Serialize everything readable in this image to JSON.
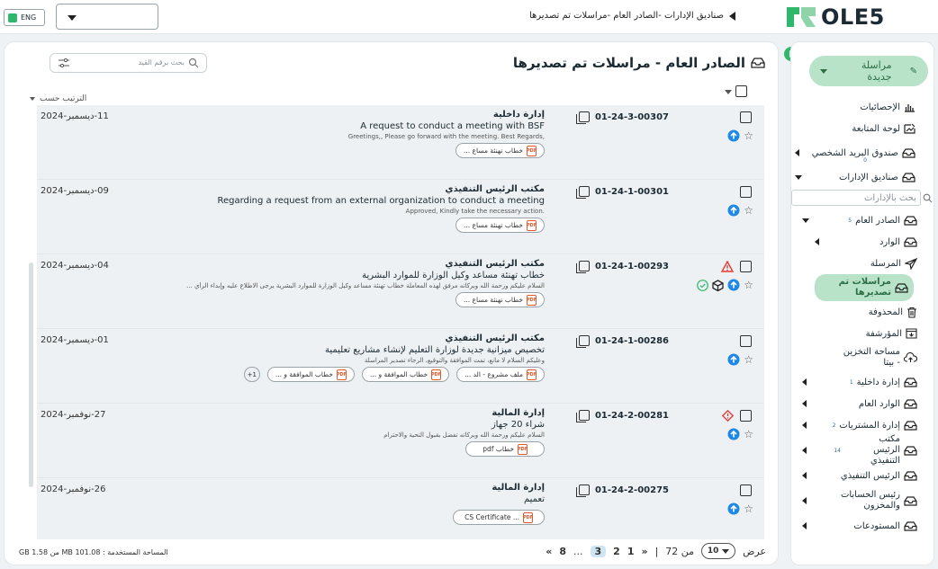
{
  "topbar": {
    "lang": "ENG",
    "breadcrumb": "صناديق الإدارات  -الصادر العام -مراسلات تم تصديرها",
    "logo_text": "OLE5"
  },
  "main": {
    "title": "الصادر العام - مراسلات تم تصديرها",
    "search_placeholder": "بحث برقم القيد",
    "sort_label": "الترتيب حسب",
    "rows": [
      {
        "ref": "01-24-3-00307",
        "dept": "إدارة داخلية",
        "subject": "A request to conduct a meeting with BSF",
        "preview": "Greetings,, Please go forward with the meeting. Best Regards,",
        "date": "11-ديسمبر-2024",
        "attachments": [
          "خطاب تهنئة مساع ..."
        ],
        "flags": {
          "warn": false,
          "diamond": false,
          "extra": false
        }
      },
      {
        "ref": "01-24-1-00301",
        "dept": "مكتب الرئيس التنفيذي",
        "subject": "Regarding a request from an external organization to conduct a meeting",
        "preview": "Approved, Kindly take the necessary action.",
        "date": "09-ديسمبر-2024",
        "attachments": [
          "خطاب تهنئة مساع ..."
        ],
        "flags": {
          "warn": false,
          "diamond": false,
          "extra": false
        }
      },
      {
        "ref": "01-24-1-00293",
        "dept": "مكتب الرئيس التنفيذي",
        "subject": "خطاب تهنئة مساعد وكيل الوزارة للموارد البشرية",
        "preview": "السلام عليكم ورحمة الله وبركاته مرفق لهذه المعاملة خطاب تهنئة مساعد وكيل الوزارة للموارد البشرية يرجى الاطلاع عليه وإبداء الرأي ...",
        "date": "04-ديسمبر-2024",
        "attachments": [
          "خطاب تهنئة مساع ..."
        ],
        "flags": {
          "warn": true,
          "diamond": false,
          "extra": true
        }
      },
      {
        "ref": "01-24-1-00286",
        "dept": "مكتب الرئيس التنفيذي",
        "subject": "تخصيص ميزانية جديدة لوزارة التعليم لإنشاء مشاريع تعليمية",
        "preview": "وعليكم السلام لا مانع، تمت الموافقة والتوقيع، الرجاء تصدير المراسلة",
        "date": "01-ديسمبر-2024",
        "attachments": [
          "ملف مشروع - الد ...",
          "خطاب الموافقة و ...",
          "خطاب الموافقة و ..."
        ],
        "more": "1+",
        "flags": {
          "warn": false,
          "diamond": false,
          "extra": false
        }
      },
      {
        "ref": "01-24-2-00281",
        "dept": "إدارة المالية",
        "subject": "شراء 20 جهاز",
        "preview": "السلام عليكم ورحمة الله وبركاته تفضل بقبول التحية والاحترام",
        "date": "27-نوفمبر-2024",
        "attachments": [
          "خطاب pdf"
        ],
        "flags": {
          "warn": false,
          "diamond": true,
          "extra": false
        }
      },
      {
        "ref": "01-24-2-00275",
        "dept": "إدارة المالية",
        "subject": "تعميم",
        "preview": "",
        "date": "26-نوفمبر-2024",
        "attachments": [
          "CS Certificate ..."
        ],
        "flags": {
          "warn": false,
          "diamond": false,
          "extra": false
        }
      }
    ],
    "footer": {
      "space_used": "المساحة المستخدمة : 101.08 MB من 1.58 GB",
      "show_label": "عرض",
      "page_size": "10",
      "of_label": "من 72",
      "sep": "|",
      "pages": [
        "1",
        "2",
        "3",
        "...",
        "8"
      ],
      "current_page": "3",
      "first": "«",
      "last": "»"
    }
  },
  "sidebar": {
    "new_message": "مراسلة جديدة",
    "search_placeholder": "بحث بالإدارات",
    "items": [
      {
        "label": "الإحصائيات",
        "level": 1
      },
      {
        "label": "لوحة المتابعة",
        "level": 1
      },
      {
        "label": "صندوق البريد الشخصي",
        "level": 1,
        "badge": "0",
        "arrow": "left"
      },
      {
        "label": "صناديق الإدارات",
        "level": 1,
        "arrow": "down"
      },
      {
        "label": "الصادر العام",
        "level": 2,
        "badge": "5",
        "arrow": "down"
      },
      {
        "label": "الوارد",
        "level": 3,
        "arrow": "left"
      },
      {
        "label": "المرسلة",
        "level": 3
      },
      {
        "label": "مراسلات تم تصديرها",
        "level": 3,
        "active": true
      },
      {
        "label": "المحذوفة",
        "level": 3
      },
      {
        "label": "المؤرشفة",
        "level": 3
      },
      {
        "label": "مساحة التخزين - بيتا",
        "level": 3
      },
      {
        "label": "إدارة داخلية",
        "level": 2,
        "badge": "1",
        "arrow": "left"
      },
      {
        "label": "الوارد العام",
        "level": 2,
        "arrow": "left"
      },
      {
        "label": "إدارة المشتريات",
        "level": 2,
        "badge": "2",
        "arrow": "left"
      },
      {
        "label": "مكتب الرئيس التنفيذي",
        "level": 2,
        "badge": "14",
        "arrow": "left"
      },
      {
        "label": "الرئيس التنفيذي",
        "level": 2,
        "arrow": "left"
      },
      {
        "label": "رئيس الحسابات والمخزون",
        "level": 2,
        "arrow": "left"
      },
      {
        "label": "المستودعات",
        "level": 2,
        "arrow": "left"
      }
    ]
  }
}
